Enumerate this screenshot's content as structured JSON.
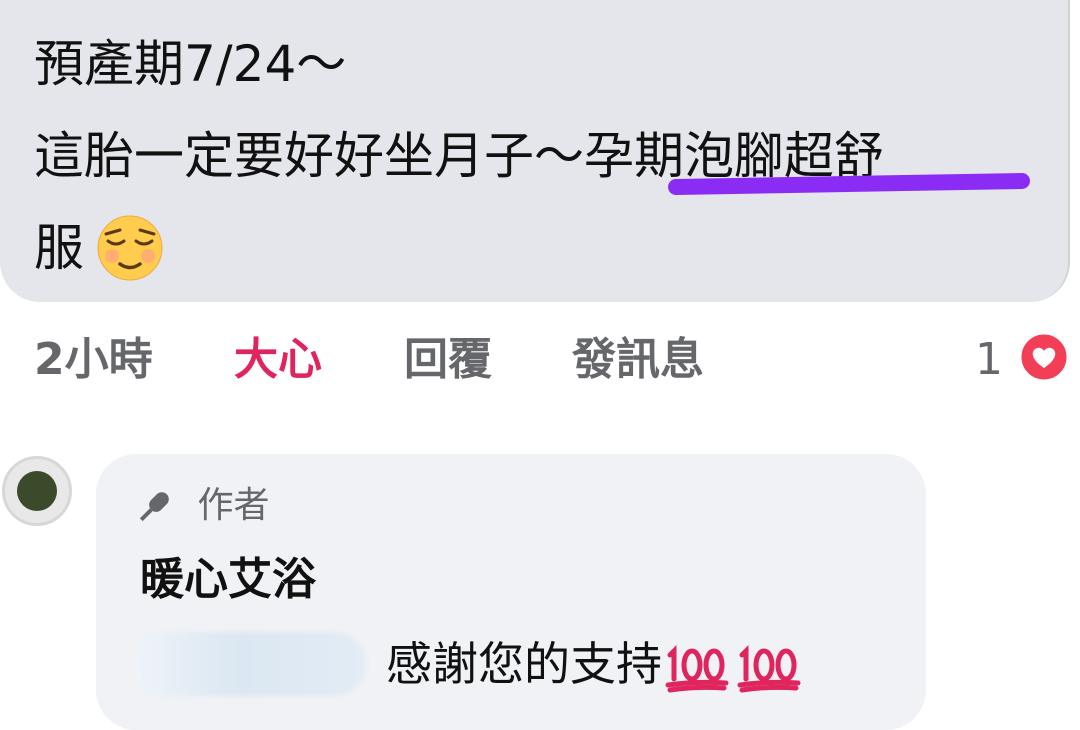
{
  "comment": {
    "line1": "預產期7/24～",
    "line2": "這胎一定要好好坐月子～孕期泡腳超舒",
    "line3": "服",
    "emoji": "relieved-face-icon",
    "underline_color": "#8b2cf5"
  },
  "actions": {
    "time": "2小時",
    "like": "大心",
    "reply": "回覆",
    "message": "發訊息",
    "like_color": "#e0245e"
  },
  "reactions": {
    "count": "1",
    "type": "heart-icon",
    "color": "#f33e58"
  },
  "reply": {
    "badge_icon": "microphone-icon",
    "badge": "作者",
    "author": "暖心艾浴",
    "text": "感謝您的支持",
    "emoji": "hundred-points-icon"
  }
}
